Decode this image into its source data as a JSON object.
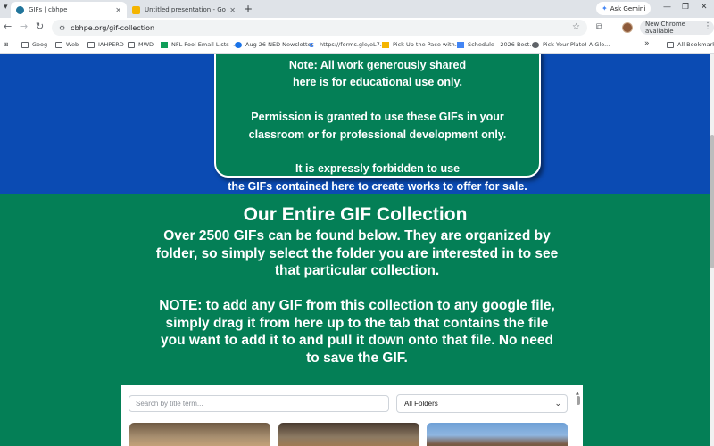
{
  "browser": {
    "tabs": [
      {
        "title": "GIFs | cbhpe",
        "active": true,
        "favicon_color": "#21759b"
      },
      {
        "title": "Untitled presentation - Google Sl...",
        "active": false,
        "favicon_color": "#f4b400"
      }
    ],
    "new_tab_symbol": "+",
    "ask_gemini": "Ask Gemini",
    "url": "cbhpe.org/gif-collection",
    "update_label": "New Chrome available",
    "bookmarks": [
      {
        "label": "Goog",
        "icon": "folder-icon"
      },
      {
        "label": "Web",
        "icon": "folder-icon"
      },
      {
        "label": "IAHPERD",
        "icon": "folder-icon"
      },
      {
        "label": "MWD",
        "icon": "folder-icon"
      },
      {
        "label": "NFL Pool Email Lists -...",
        "icon": "sheets-icon"
      },
      {
        "label": "Aug 26 NED Newsletter",
        "icon": "site-icon"
      },
      {
        "label": "https://forms.gle/eL7...",
        "icon": "google-icon"
      },
      {
        "label": "Pick Up the Pace with...",
        "icon": "slides-icon"
      },
      {
        "label": "Schedule - 2026 Best...",
        "icon": "docs-icon"
      },
      {
        "label": "Pick Your Plate! A Glo...",
        "icon": "site-icon"
      }
    ],
    "more_bookmarks": "»",
    "all_bookmarks": "All Bookmarks"
  },
  "page": {
    "notice_lines": [
      "Note: All work generously shared",
      "here is for educational use only.",
      "",
      "Permission is granted to use these GIFs in your",
      "classroom or for professional development only.",
      "",
      "It is expressly forbidden to use",
      "the GIFs contained here to create works to offer for sale."
    ],
    "collection_title": "Our Entire GIF Collection",
    "collection_lines": [
      "Over 2500 GIFs can be found below.  They are organized by",
      "folder, so simply select the folder you are interested in to see",
      "that particular collection.",
      "",
      "NOTE: to add any GIF from this collection to any google file,",
      "simply drag it from here up to the tab that contains the file",
      "you want to add it to and pull it down onto that file.  No need",
      "to save the GIF."
    ],
    "search": {
      "placeholder": "Search by title term..."
    },
    "folder_select": {
      "selected": "All Folders"
    },
    "colors": {
      "blue_band": "#0b4bb3",
      "green": "#047f56"
    }
  }
}
